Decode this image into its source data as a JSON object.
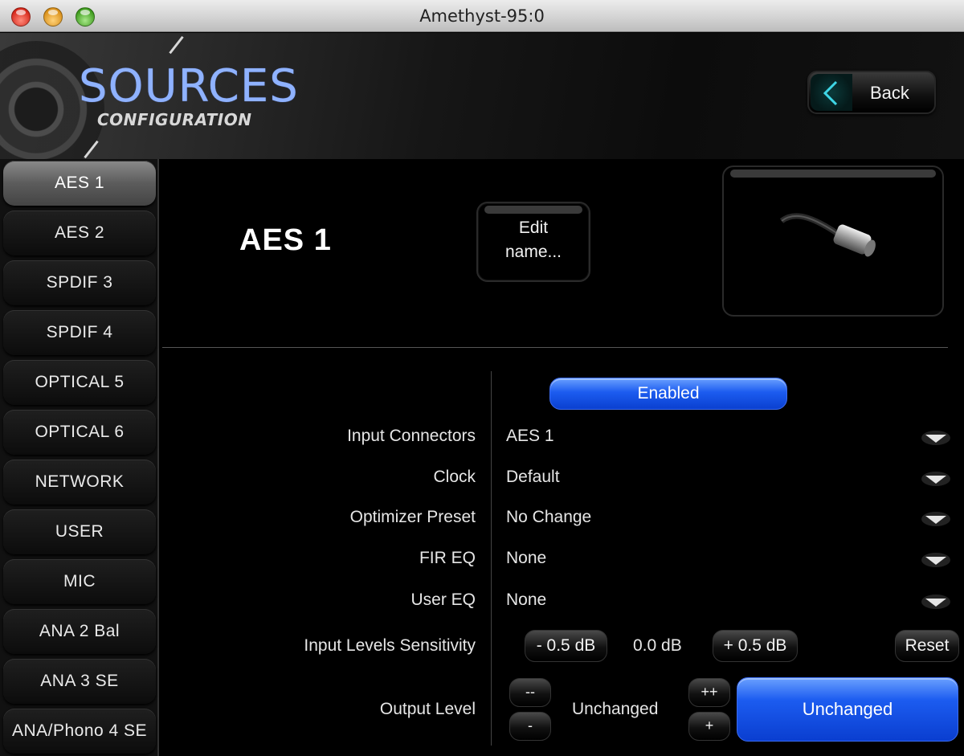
{
  "window": {
    "title": "Amethyst-95:0"
  },
  "header": {
    "title": "SOURCES",
    "subtitle": "CONFIGURATION",
    "back_label": "Back",
    "accent_color": "#8fb2ff"
  },
  "sidebar": {
    "selected": "AES 1",
    "items": [
      {
        "label": "AES 1"
      },
      {
        "label": "AES 2"
      },
      {
        "label": "SPDIF 3"
      },
      {
        "label": "SPDIF 4"
      },
      {
        "label": "OPTICAL 5"
      },
      {
        "label": "OPTICAL 6"
      },
      {
        "label": "NETWORK"
      },
      {
        "label": "USER"
      },
      {
        "label": "MIC"
      },
      {
        "label": "ANA 2 Bal"
      },
      {
        "label": "ANA 3 SE"
      },
      {
        "label": "ANA/Phono 4 SE"
      }
    ]
  },
  "source": {
    "name": "AES 1",
    "edit_label_line1": "Edit",
    "edit_label_line2": "name...",
    "image_icon": "xlr-cable-icon"
  },
  "settings": {
    "enabled_label": "Enabled",
    "enabled_color": "#1c5cf0",
    "input_connectors": {
      "label": "Input Connectors",
      "value": "AES 1"
    },
    "clock": {
      "label": "Clock",
      "value": "Default"
    },
    "optimizer_preset": {
      "label": "Optimizer Preset",
      "value": "No Change"
    },
    "fir_eq": {
      "label": "FIR EQ",
      "value": "None"
    },
    "user_eq": {
      "label": "User EQ",
      "value": "None"
    },
    "input_levels": {
      "label": "Input Levels Sensitivity",
      "minus_label": "- 0.5 dB",
      "value": "0.0 dB",
      "plus_label": "+ 0.5 dB",
      "reset_label": "Reset"
    },
    "output_level": {
      "label": "Output Level",
      "minus_minus_label": "--",
      "minus_label": "-",
      "value": "Unchanged",
      "plus_plus_label": "++",
      "plus_label": "+",
      "button_label": "Unchanged"
    }
  }
}
